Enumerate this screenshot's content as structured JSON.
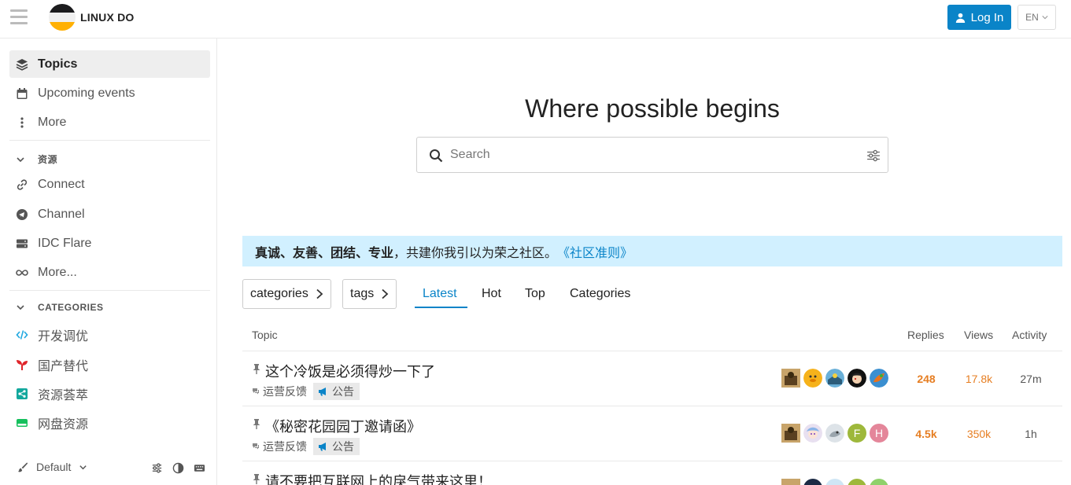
{
  "header": {
    "site_title": "LINUX DO",
    "login_label": "Log In",
    "lang_label": "EN",
    "accent": "#0a84c8"
  },
  "sidebar": {
    "primary": [
      {
        "label": "Topics",
        "icon": "layers-icon",
        "active": true
      },
      {
        "label": "Upcoming events",
        "icon": "calendar-icon"
      },
      {
        "label": "More",
        "icon": "ellipsis-vertical-icon"
      }
    ],
    "resources_title": "资源",
    "resources": [
      {
        "label": "Connect",
        "icon": "link-icon"
      },
      {
        "label": "Channel",
        "icon": "telegram-icon"
      },
      {
        "label": "IDC Flare",
        "icon": "server-icon"
      },
      {
        "label": "More...",
        "icon": "infinity-icon"
      }
    ],
    "categories_title": "CATEGORIES",
    "categories": [
      {
        "label": "开发调优",
        "icon": "code-icon",
        "color": "#25aae1"
      },
      {
        "label": "国产替代",
        "icon": "seedling-icon",
        "color": "#e0252a"
      },
      {
        "label": "资源荟萃",
        "icon": "share-icon",
        "color": "#12a89d"
      },
      {
        "label": "网盘资源",
        "icon": "hard-drive-icon",
        "color": "#16c05d"
      }
    ],
    "footer": {
      "theme_label": "Default"
    }
  },
  "hero": {
    "title": "Where possible begins"
  },
  "search": {
    "placeholder": "Search"
  },
  "banner": {
    "bold": "真诚、友善、团结、专业",
    "text": "，共建你我引以为荣之社区。",
    "link": "《社区准则》"
  },
  "filters": {
    "categories": "categories",
    "tags": "tags"
  },
  "tabs": [
    "Latest",
    "Hot",
    "Top",
    "Categories"
  ],
  "active_tab": "Latest",
  "table": {
    "headers": {
      "topic": "Topic",
      "replies": "Replies",
      "views": "Views",
      "activity": "Activity"
    },
    "rows": [
      {
        "title": "这个冷饭是必须得炒一下了",
        "category": "运营反馈",
        "tag": "公告",
        "replies": "248",
        "views": "17.8k",
        "activity": "27m",
        "pinned": true
      },
      {
        "title": "《秘密花园园丁邀请函》",
        "category": "运营反馈",
        "tag": "公告",
        "replies": "4.5k",
        "views": "350k",
        "activity": "1h",
        "pinned": true
      },
      {
        "title": "请不要把互联网上的戾气带来这里！",
        "pinned": true
      }
    ],
    "letter_avatars": {
      "row2_a": "F",
      "row2_b": "H"
    }
  }
}
